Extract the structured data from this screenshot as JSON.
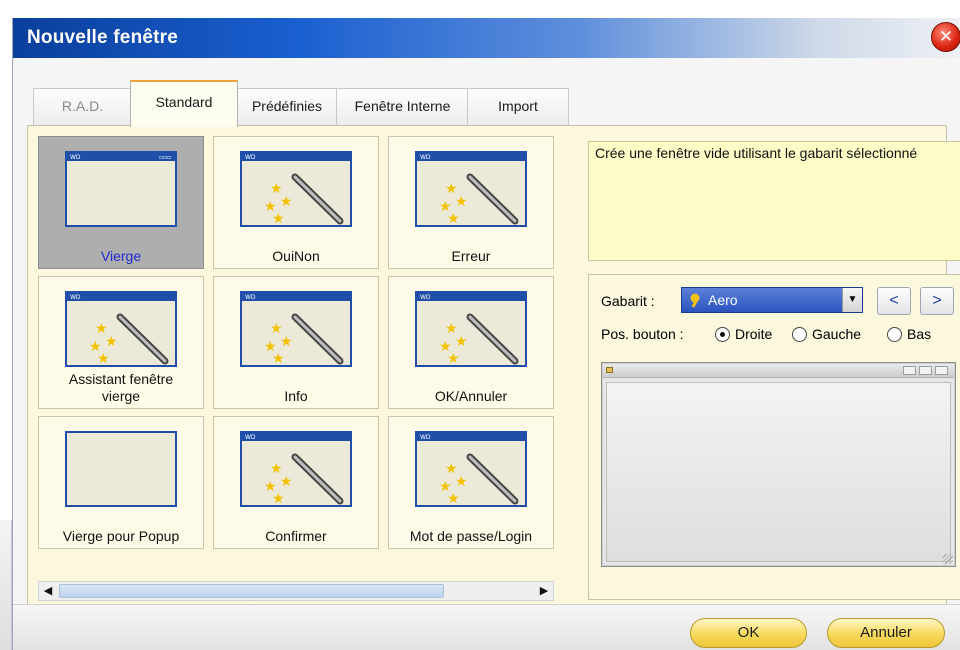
{
  "window": {
    "title": "Nouvelle fenêtre",
    "close_glyph": "✕"
  },
  "tabs": [
    {
      "label": "R.A.D.",
      "state": "disabled"
    },
    {
      "label": "Standard",
      "state": "active"
    },
    {
      "label": "Prédéfinies",
      "state": "normal"
    },
    {
      "label": "Fenêtre Interne",
      "state": "normal"
    },
    {
      "label": "Import",
      "state": "normal"
    }
  ],
  "templates": [
    {
      "label": "Vierge",
      "icon": "blank-window-icon",
      "selected": true
    },
    {
      "label": "OuiNon",
      "icon": "wizard-window-icon",
      "selected": false
    },
    {
      "label": "Erreur",
      "icon": "wizard-window-icon",
      "selected": false
    },
    {
      "label": "Assistant fenêtre vierge",
      "icon": "wizard-window-icon",
      "selected": false
    },
    {
      "label": "Info",
      "icon": "wizard-window-icon",
      "selected": false
    },
    {
      "label": "OK/Annuler",
      "icon": "wizard-window-icon",
      "selected": false
    },
    {
      "label": "Vierge pour Popup",
      "icon": "popup-window-icon",
      "selected": false
    },
    {
      "label": "Confirmer",
      "icon": "wizard-window-icon",
      "selected": false
    },
    {
      "label": "Mot de passe/Login",
      "icon": "wizard-window-icon",
      "selected": false
    }
  ],
  "description": "Crée une fenêtre vide utilisant le gabarit sélectionné",
  "options": {
    "gabarit_label": "Gabarit :",
    "gabarit_value": "Aero",
    "prev_label": "<",
    "next_label": ">",
    "pos_label": "Pos. bouton :",
    "positions": [
      {
        "label": "Droite",
        "checked": true
      },
      {
        "label": "Gauche",
        "checked": false
      },
      {
        "label": "Bas",
        "checked": false
      }
    ]
  },
  "buttons": {
    "ok": "OK",
    "cancel": "Annuler"
  },
  "colors": {
    "title_bar": "#1a5fd0",
    "panel": "#fbf8de",
    "selection": "#aeaeae",
    "button": "#f6d85a"
  }
}
